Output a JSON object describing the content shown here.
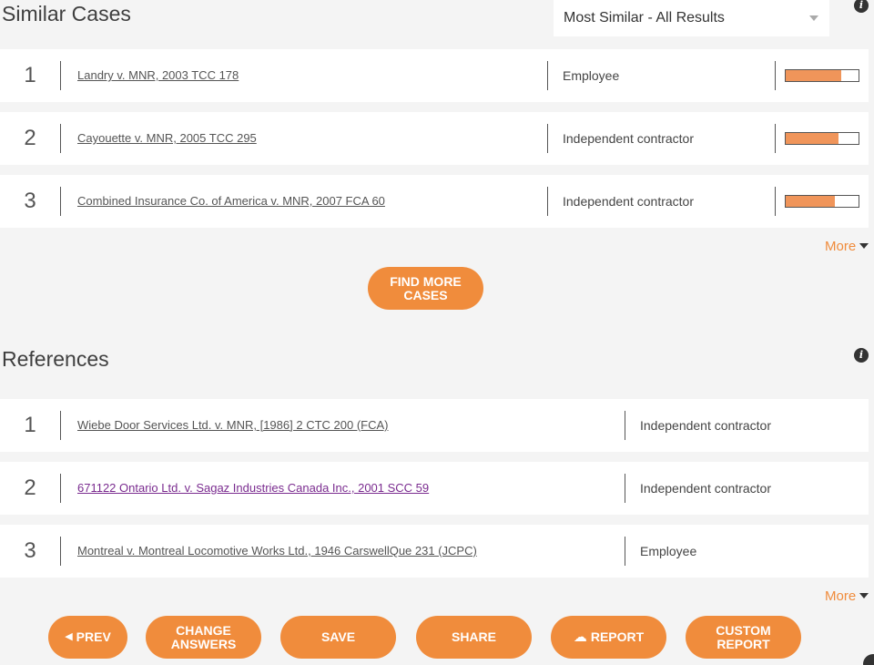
{
  "similar_cases": {
    "title": "Similar Cases",
    "sort_selected": "Most Similar - All Results",
    "more_label": "More",
    "find_more_label": "FIND MORE\nCASES",
    "rows": [
      {
        "num": "1",
        "case": "Landry v. MNR, 2003 TCC 178",
        "outcome": "Employee",
        "similarity": 0.76
      },
      {
        "num": "2",
        "case": "Cayouette v. MNR, 2005 TCC 295",
        "outcome": "Independent contractor",
        "similarity": 0.72
      },
      {
        "num": "3",
        "case": "Combined Insurance Co. of America v. MNR, 2007 FCA 60",
        "outcome": "Independent contractor",
        "similarity": 0.68
      }
    ]
  },
  "references": {
    "title": "References",
    "more_label": "More",
    "rows": [
      {
        "num": "1",
        "case": "Wiebe Door Services Ltd. v. MNR, [1986] 2 CTC 200 (FCA)",
        "outcome": "Independent contractor"
      },
      {
        "num": "2",
        "case": "671122 Ontario Ltd. v. Sagaz Industries Canada Inc., 2001 SCC 59",
        "outcome": "Independent contractor"
      },
      {
        "num": "3",
        "case": "Montreal v. Montreal Locomotive Works Ltd., 1946 CarswellQue 231 (JCPC)",
        "outcome": "Employee"
      }
    ]
  },
  "footer": {
    "prev": "PREV",
    "change_answers": "CHANGE\nANSWERS",
    "save": "SAVE",
    "share": "SHARE",
    "report": "REPORT",
    "custom_report": "CUSTOM\nREPORT"
  },
  "colors": {
    "accent": "#f08c3c",
    "bar_fill": "#f0955a",
    "background": "#f4f4f4",
    "visited_link": "#7a2b8f"
  },
  "icons": {
    "info": "info-icon",
    "caret": "caret-down-icon",
    "prev": "triangle-left-icon",
    "report": "cloud-upload-icon"
  }
}
